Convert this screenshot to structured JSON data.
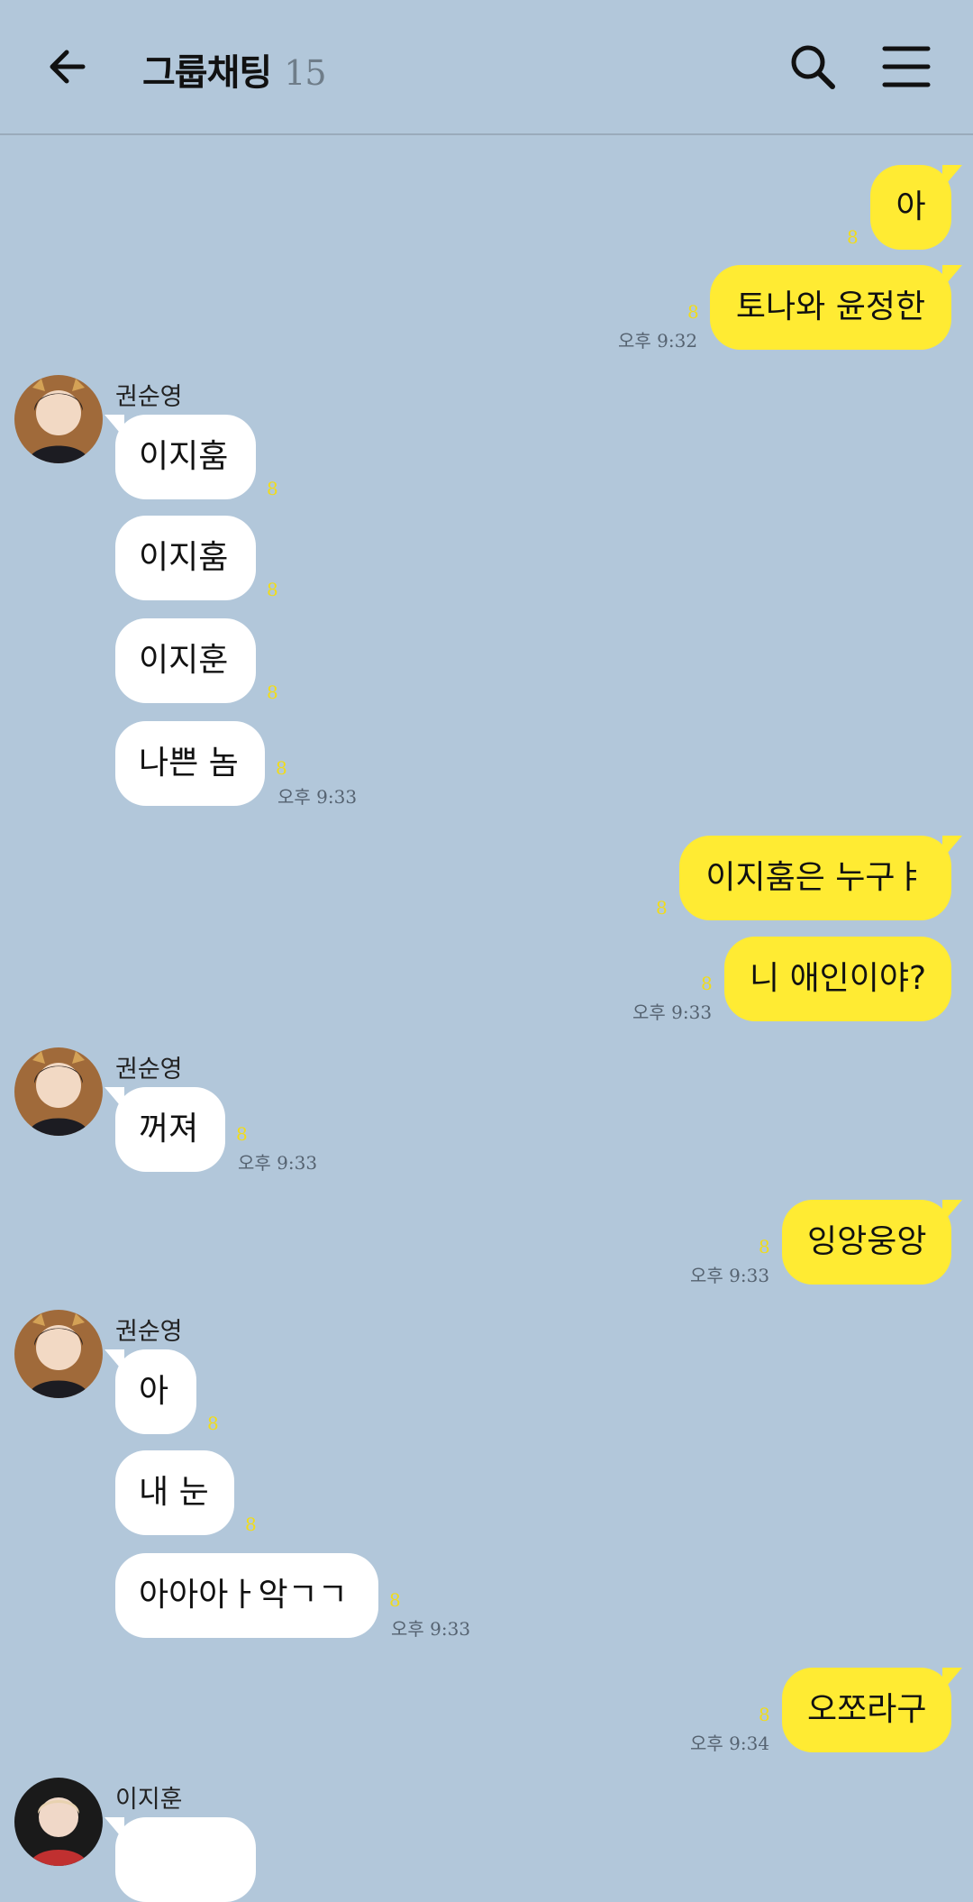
{
  "header": {
    "title": "그룹채팅",
    "member_count": "15"
  },
  "messages": [
    {
      "text": "아",
      "unread": "8"
    },
    {
      "text": "토나와 윤정한",
      "unread": "8",
      "time": "오후 9:32"
    },
    {
      "sender": "권순영"
    },
    {
      "text": "이지훔",
      "unread": "8"
    },
    {
      "text": "이지훔",
      "unread": "8"
    },
    {
      "text": "이지훈",
      "unread": "8"
    },
    {
      "text": "나쁜 놈",
      "unread": "8",
      "time": "오후 9:33"
    },
    {
      "text": "이지훔은 누구ㅑ",
      "unread": "8"
    },
    {
      "text": "니 애인이야?",
      "unread": "8",
      "time": "오후 9:33"
    },
    {
      "sender": "권순영"
    },
    {
      "text": "꺼져",
      "unread": "8",
      "time": "오후 9:33"
    },
    {
      "text": "잉앙웅앙",
      "unread": "8",
      "time": "오후 9:33"
    },
    {
      "sender": "권순영"
    },
    {
      "text": "아",
      "unread": "8"
    },
    {
      "text": "내 눈",
      "unread": "8"
    },
    {
      "text": "아아아ㅏ악ㄱㄱ",
      "unread": "8",
      "time": "오후 9:33"
    },
    {
      "text": "오쪼라구",
      "unread": "8",
      "time": "오후 9:34"
    },
    {
      "sender": "이지훈"
    }
  ],
  "colors": {
    "background": "#b2c7da",
    "my_bubble": "#ffeb33",
    "other_bubble": "#ffffff",
    "unread_count": "#f1dc1a"
  },
  "icons": [
    "back-arrow-icon",
    "search-icon",
    "menu-icon"
  ]
}
